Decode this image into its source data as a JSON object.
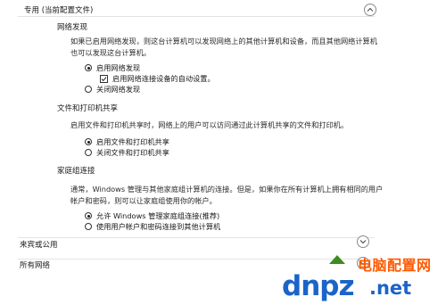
{
  "private": {
    "title": "专用 (当前配置文件)",
    "network_discovery": {
      "heading": "网络发现",
      "desc": "如果已启用网络发现，则这台计算机可以发现网络上的其他计算机和设备，而且其他网络计算机也可以发现这台计算机。",
      "opt_on": "启用网络发现",
      "opt_auto": "启用网络连接设备的自动设置。",
      "opt_off": "关闭网络发现"
    },
    "file_sharing": {
      "heading": "文件和打印机共享",
      "desc": "启用文件和打印机共享时，网络上的用户可以访问通过此计算机共享的文件和打印机。",
      "opt_on": "启用文件和打印机共享",
      "opt_off": "关闭文件和打印机共享"
    },
    "homegroup": {
      "heading": "家庭组连接",
      "desc": "通常，Windows 管理与其他家庭组计算机的连接。但是，如果你在所有计算机上拥有相同的用户帐户和密码，则可以让家庭组使用你的帐户。",
      "opt_allow": "允许 Windows 管理家庭组连接(推荐)",
      "opt_user": "使用用户帐户和密码连接到其他计算机"
    }
  },
  "guest": {
    "title": "来宾或公用"
  },
  "all": {
    "title": "所有网络"
  },
  "watermark": {
    "cn": "电脑配置网",
    "brand": "dnpz",
    "tld": ".net"
  },
  "colors": {
    "watermark_orange": "#ff5a00",
    "watermark_blue": "#1b64c8",
    "watermark_green": "#3c8d1e"
  }
}
